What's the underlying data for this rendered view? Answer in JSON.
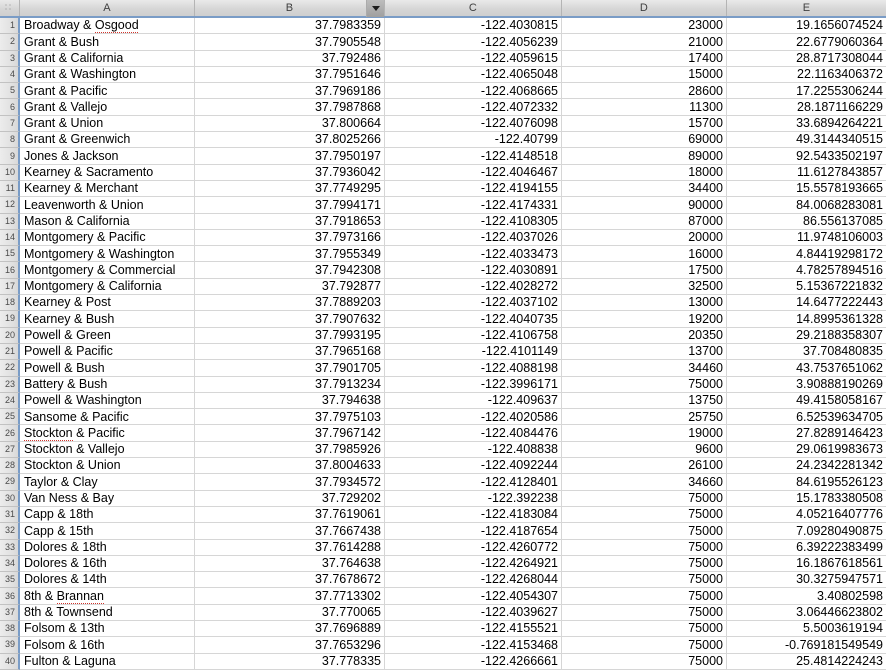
{
  "app": {
    "type": "spreadsheet",
    "corner_icon": "grid-handle-icon"
  },
  "columns": [
    {
      "id": "A",
      "label": "A",
      "align": "left",
      "has_filter": false
    },
    {
      "id": "B",
      "label": "B",
      "align": "right",
      "has_filter": true,
      "filter_icon": "chevron-down-icon"
    },
    {
      "id": "C",
      "label": "C",
      "align": "right",
      "has_filter": false
    },
    {
      "id": "D",
      "label": "D",
      "align": "right",
      "has_filter": false
    },
    {
      "id": "E",
      "label": "E",
      "align": "right",
      "has_filter": false
    }
  ],
  "colors": {
    "header_band": "#d6d6d6",
    "header_accent_border": "#7a9cc6",
    "gridline": "#d6d6d6",
    "cell_text": "#000000",
    "rownum_text": "#4a4a4a",
    "spellcheck_underline": "#d0342c"
  },
  "rows": [
    {
      "n": "1",
      "a": "Broadway & Osgood",
      "a_misspelled": "Osgood",
      "b": "37.7983359",
      "c": "-122.4030815",
      "d": "23000",
      "e": "19.1656074524"
    },
    {
      "n": "2",
      "a": "Grant & Bush",
      "b": "37.7905548",
      "c": "-122.4056239",
      "d": "21000",
      "e": "22.6779060364"
    },
    {
      "n": "3",
      "a": "Grant & California",
      "b": "37.792486",
      "c": "-122.4059615",
      "d": "17400",
      "e": "28.8717308044"
    },
    {
      "n": "4",
      "a": "Grant & Washington",
      "b": "37.7951646",
      "c": "-122.4065048",
      "d": "15000",
      "e": "22.1163406372"
    },
    {
      "n": "5",
      "a": "Grant & Pacific",
      "b": "37.7969186",
      "c": "-122.4068665",
      "d": "28600",
      "e": "17.2255306244"
    },
    {
      "n": "6",
      "a": "Grant & Vallejo",
      "b": "37.7987868",
      "c": "-122.4072332",
      "d": "11300",
      "e": "28.1871166229"
    },
    {
      "n": "7",
      "a": "Grant & Union",
      "b": "37.800664",
      "c": "-122.4076098",
      "d": "15700",
      "e": "33.6894264221"
    },
    {
      "n": "8",
      "a": "Grant & Greenwich",
      "b": "37.8025266",
      "c": "-122.40799",
      "d": "69000",
      "e": "49.3144340515"
    },
    {
      "n": "9",
      "a": "Jones & Jackson",
      "b": "37.7950197",
      "c": "-122.4148518",
      "d": "89000",
      "e": "92.5433502197"
    },
    {
      "n": "10",
      "a": "Kearney & Sacramento",
      "b": "37.7936042",
      "c": "-122.4046467",
      "d": "18000",
      "e": "11.6127843857"
    },
    {
      "n": "11",
      "a": "Kearney & Merchant",
      "b": "37.7749295",
      "c": "-122.4194155",
      "d": "34400",
      "e": "15.5578193665"
    },
    {
      "n": "12",
      "a": "Leavenworth & Union",
      "b": "37.7994171",
      "c": "-122.4174331",
      "d": "90000",
      "e": "84.0068283081"
    },
    {
      "n": "13",
      "a": "Mason & California",
      "b": "37.7918653",
      "c": "-122.4108305",
      "d": "87000",
      "e": "86.556137085"
    },
    {
      "n": "14",
      "a": "Montgomery & Pacific",
      "b": "37.7973166",
      "c": "-122.4037026",
      "d": "20000",
      "e": "11.9748106003"
    },
    {
      "n": "15",
      "a": "Montgomery & Washington",
      "b": "37.7955349",
      "c": "-122.4033473",
      "d": "16000",
      "e": "4.84419298172"
    },
    {
      "n": "16",
      "a": "Montgomery & Commercial",
      "b": "37.7942308",
      "c": "-122.4030891",
      "d": "17500",
      "e": "4.78257894516"
    },
    {
      "n": "17",
      "a": "Montgomery & California",
      "b": "37.792877",
      "c": "-122.4028272",
      "d": "32500",
      "e": "5.15367221832"
    },
    {
      "n": "18",
      "a": "Kearney & Post",
      "b": "37.7889203",
      "c": "-122.4037102",
      "d": "13000",
      "e": "14.6477222443"
    },
    {
      "n": "19",
      "a": "Kearney & Bush",
      "b": "37.7907632",
      "c": "-122.4040735",
      "d": "19200",
      "e": "14.8995361328"
    },
    {
      "n": "20",
      "a": "Powell & Green",
      "b": "37.7993195",
      "c": "-122.4106758",
      "d": "20350",
      "e": "29.2188358307"
    },
    {
      "n": "21",
      "a": "Powell & Pacific",
      "b": "37.7965168",
      "c": "-122.4101149",
      "d": "13700",
      "e": "37.708480835"
    },
    {
      "n": "22",
      "a": "Powell & Bush",
      "b": "37.7901705",
      "c": "-122.4088198",
      "d": "34460",
      "e": "43.7537651062"
    },
    {
      "n": "23",
      "a": "Battery & Bush",
      "b": "37.7913234",
      "c": "-122.3996171",
      "d": "75000",
      "e": "3.90888190269"
    },
    {
      "n": "24",
      "a": "Powell & Washington",
      "b": "37.794638",
      "c": "-122.409637",
      "d": "13750",
      "e": "49.4158058167"
    },
    {
      "n": "25",
      "a": "Sansome & Pacific",
      "a_misspelled": "Sansome",
      "b": "37.7975103",
      "c": "-122.4020586",
      "d": "25750",
      "e": "6.52539634705"
    },
    {
      "n": "26",
      "a": "Stockton & Pacific",
      "a_misspelled": "Stockton",
      "b": "37.7967142",
      "c": "-122.4084476",
      "d": "19000",
      "e": "27.8289146423"
    },
    {
      "n": "27",
      "a": "Stockton & Vallejo",
      "b": "37.7985926",
      "c": "-122.408838",
      "d": "9600",
      "e": "29.0619983673"
    },
    {
      "n": "28",
      "a": "Stockton & Union",
      "b": "37.8004633",
      "c": "-122.4092244",
      "d": "26100",
      "e": "24.2342281342"
    },
    {
      "n": "29",
      "a": "Taylor & Clay",
      "b": "37.7934572",
      "c": "-122.4128401",
      "d": "34660",
      "e": "84.6195526123"
    },
    {
      "n": "30",
      "a": "Van Ness & Bay",
      "b": "37.729202",
      "c": "-122.392238",
      "d": "75000",
      "e": "15.1783380508"
    },
    {
      "n": "31",
      "a": "Capp & 18th",
      "b": "37.7619061",
      "c": "-122.4183084",
      "d": "75000",
      "e": "4.05216407776"
    },
    {
      "n": "32",
      "a": "Capp & 15th",
      "b": "37.7667438",
      "c": "-122.4187654",
      "d": "75000",
      "e": "7.09280490875"
    },
    {
      "n": "33",
      "a": "Dolores & 18th",
      "b": "37.7614288",
      "c": "-122.4260772",
      "d": "75000",
      "e": "6.39222383499"
    },
    {
      "n": "34",
      "a": "Dolores & 16th",
      "b": "37.764638",
      "c": "-122.4264921",
      "d": "75000",
      "e": "16.1867618561"
    },
    {
      "n": "35",
      "a": "Dolores & 14th",
      "b": "37.7678672",
      "c": "-122.4268044",
      "d": "75000",
      "e": "30.3275947571"
    },
    {
      "n": "36",
      "a": "8th & Brannan",
      "a_misspelled": "Brannan",
      "b": "37.7713302",
      "c": "-122.4054307",
      "d": "75000",
      "e": "3.40802598"
    },
    {
      "n": "37",
      "a": "8th & Townsend",
      "b": "37.770065",
      "c": "-122.4039627",
      "d": "75000",
      "e": "3.06446623802"
    },
    {
      "n": "38",
      "a": "Folsom & 13th",
      "b": "37.7696889",
      "c": "-122.4155521",
      "d": "75000",
      "e": "5.5003619194"
    },
    {
      "n": "39",
      "a": "Folsom & 16th",
      "b": "37.7653296",
      "c": "-122.4153468",
      "d": "75000",
      "e": "-0.769181549549"
    },
    {
      "n": "40",
      "a": "Fulton & Laguna",
      "b": "37.778335",
      "c": "-122.4266661",
      "d": "75000",
      "e": "25.4814224243"
    }
  ]
}
